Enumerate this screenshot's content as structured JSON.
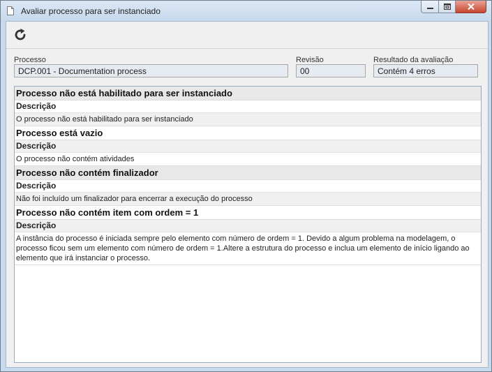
{
  "window": {
    "title": "Avaliar processo para ser instanciado",
    "icon": "document-icon"
  },
  "window_controls": {
    "minimize": "‒",
    "maximize": "□",
    "close": "✕"
  },
  "toolbar": {
    "refresh_icon": "refresh-icon"
  },
  "fields": {
    "processo_label": "Processo",
    "processo_value": "DCP.001 - Documentation process",
    "revisao_label": "Revisão",
    "revisao_value": "00",
    "resultado_label": "Resultado da avaliação",
    "resultado_value": "Contém 4 erros"
  },
  "issues": [
    {
      "title": "Processo não está habilitado para ser instanciado",
      "desc_label": "Descrição",
      "desc": "O processo não está habilitado para ser instanciado"
    },
    {
      "title": "Processo está vazio",
      "desc_label": "Descrição",
      "desc": "O processo não contém atividades"
    },
    {
      "title": "Processo não contém finalizador",
      "desc_label": "Descrição",
      "desc": "Não foi incluído um finalizador para encerrar a execução do processo"
    },
    {
      "title": "Processo não contém item com ordem = 1",
      "desc_label": "Descrição",
      "desc": "A instância do processo é iniciada sempre pelo elemento com número de ordem = 1. Devido a algum problema na modelagem, o processo ficou sem um elemento com número de ordem = 1.Altere a estrutura do processo e inclua um elemento de início ligando ao elemento que irá instanciar o processo."
    }
  ]
}
